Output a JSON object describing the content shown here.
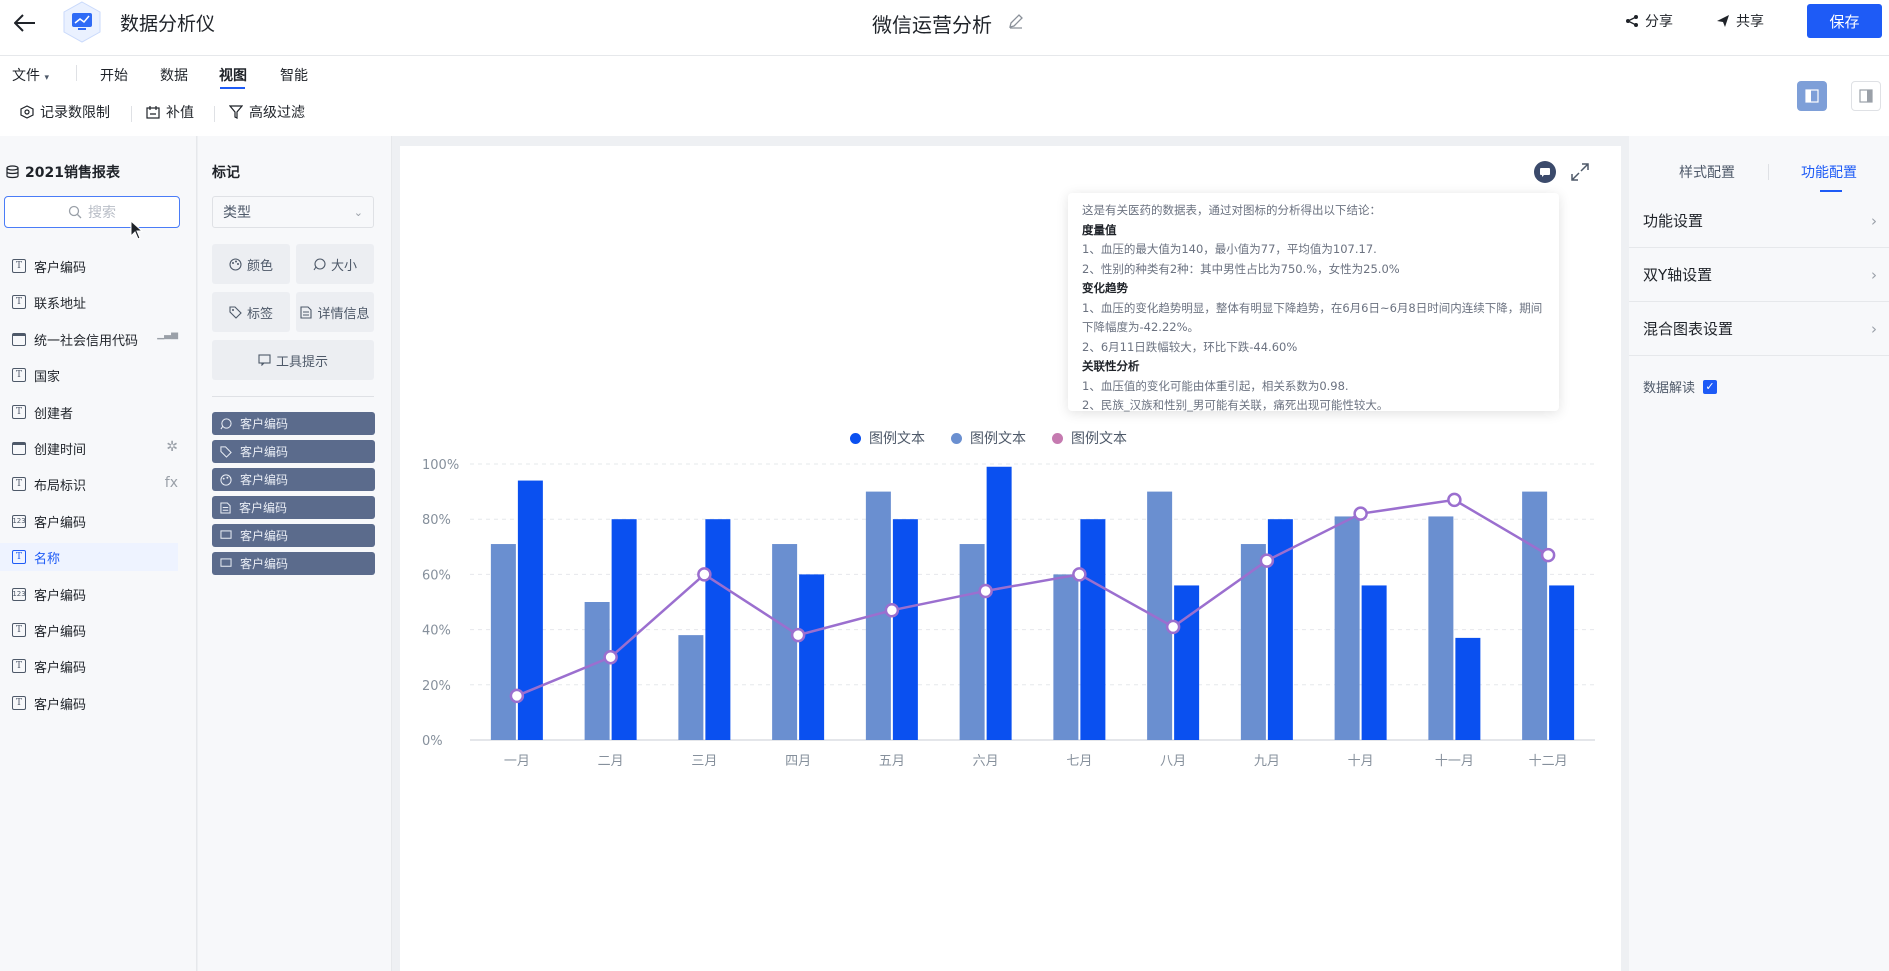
{
  "header": {
    "app_name": "数据分析仪",
    "doc_title": "微信运营分析",
    "share": "分享",
    "co_share": "共享",
    "save": "保存"
  },
  "menu": {
    "tabs": [
      "文件",
      "开始",
      "数据",
      "视图",
      "智能"
    ],
    "active_tab": "视图"
  },
  "toolbar": {
    "record_limit": "记录数限制",
    "fill_value": "补值",
    "advanced_filter": "高级过滤"
  },
  "fields_panel": {
    "dataset": "2021销售报表",
    "search_placeholder": "搜索",
    "fields": [
      {
        "label": "客户编码",
        "type": "text"
      },
      {
        "label": "联系地址",
        "type": "text"
      },
      {
        "label": "统一社会信用代码",
        "type": "calendar",
        "right": "chart"
      },
      {
        "label": "国家",
        "type": "text"
      },
      {
        "label": "创建者",
        "type": "text"
      },
      {
        "label": "创建时间",
        "type": "calendar",
        "right": "spinner"
      },
      {
        "label": "布局标识",
        "type": "text",
        "right": "fx"
      },
      {
        "label": "客户编码",
        "type": "number"
      },
      {
        "label": "名称",
        "type": "text",
        "selected": true
      },
      {
        "label": "客户编码",
        "type": "number"
      },
      {
        "label": "客户编码",
        "type": "text"
      },
      {
        "label": "客户编码",
        "type": "text"
      },
      {
        "label": "客户编码",
        "type": "text"
      }
    ]
  },
  "marks_panel": {
    "title": "标记",
    "type_select": "类型",
    "buttons": [
      "颜色",
      "大小",
      "标签",
      "详情信息",
      "工具提示"
    ],
    "pills": [
      "客户编码",
      "客户编码",
      "客户编码",
      "客户编码",
      "客户编码",
      "客户编码"
    ]
  },
  "insight": {
    "intro": "这是有关医药的数据表，通过对图标的分析得出以下结论：",
    "sections": [
      {
        "heading": "度量值",
        "lines": [
          "1、血压的最大值为140，最小值为77，平均值为107.17.",
          "2、性别的种类有2种：其中男性占比为750.%，女性为25.0%"
        ]
      },
      {
        "heading": "变化趋势",
        "lines": [
          "1、血压的变化趋势明显，整体有明显下降趋势，在6月6日~6月8日时间内连续下降，期间下降幅度为-42.22%。",
          "2、6月11日跌幅较大，环比下跌-44.60%"
        ]
      },
      {
        "heading": "关联性分析",
        "lines": [
          "1、血压值的变化可能由体重引起，相关系数为0.98.",
          "2、民族_汉族和性别_男可能有关联，痛死出现可能性较大。"
        ]
      }
    ]
  },
  "colors": {
    "accent": "#1e5bf6",
    "series_light": "#6a8fd0",
    "series_dark": "#0a50f0",
    "series_line": "#9b6fcf"
  },
  "chart_data": {
    "type": "bar",
    "categories": [
      "一月",
      "二月",
      "三月",
      "四月",
      "五月",
      "六月",
      "七月",
      "八月",
      "九月",
      "十月",
      "十一月",
      "十二月"
    ],
    "series": [
      {
        "name": "图例文本",
        "type": "bar",
        "values": [
          71,
          50,
          38,
          71,
          90,
          71,
          60,
          90,
          71,
          81,
          81,
          90
        ]
      },
      {
        "name": "图例文本",
        "type": "bar",
        "values": [
          94,
          80,
          80,
          60,
          80,
          99,
          80,
          56,
          80,
          56,
          37,
          56
        ]
      },
      {
        "name": "图例文本",
        "type": "line",
        "values": [
          16,
          30,
          60,
          38,
          47,
          54,
          60,
          41,
          65,
          82,
          87,
          67
        ]
      }
    ],
    "y_ticks": [
      "0%",
      "20%",
      "40%",
      "60%",
      "80%",
      "100%"
    ],
    "ylim": [
      0,
      100
    ],
    "y_unit": "%",
    "grid": true,
    "legend_position": "top-center"
  },
  "right_panel": {
    "tabs": [
      "样式配置",
      "功能配置"
    ],
    "active_tab": "功能配置",
    "rows": [
      "功能设置",
      "双Y轴设置",
      "混合图表设置"
    ],
    "data_insight_label": "数据解读",
    "data_insight_checked": true
  }
}
